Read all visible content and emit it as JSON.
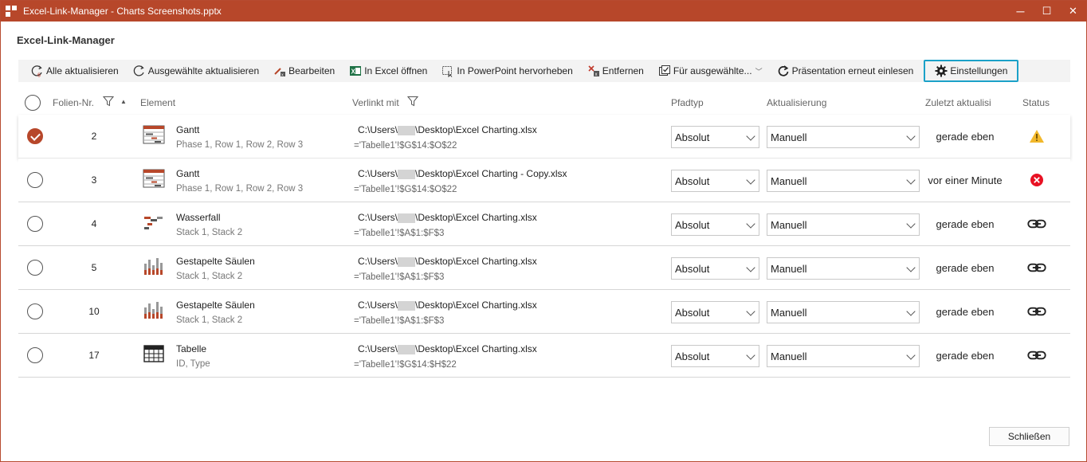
{
  "window": {
    "title": "Excel-Link-Manager - Charts Screenshots.pptx",
    "accent": "#b7472a",
    "controls": {
      "minimize": "─",
      "maximize": "☐",
      "close": "✕"
    }
  },
  "dialog": {
    "title": "Excel-Link-Manager"
  },
  "toolbar": {
    "refresh_all": "Alle aktualisieren",
    "refresh_selected": "Ausgewählte aktualisieren",
    "edit": "Bearbeiten",
    "open_excel": "In Excel öffnen",
    "highlight_ppt": "In PowerPoint hervorheben",
    "remove": "Entfernen",
    "for_selected": "Für ausgewählte...",
    "reload": "Präsentation erneut einlesen",
    "settings": "Einstellungen",
    "active_border_color": "#1ba1c8"
  },
  "columns": {
    "slide": "Folien-Nr.",
    "element": "Element",
    "linked": "Verlinkt mit",
    "path_type": "Pfadtyp",
    "update": "Aktualisierung",
    "last_updated": "Zuletzt aktualisi",
    "status": "Status"
  },
  "rows": [
    {
      "selected": true,
      "slide": "2",
      "icon": "gantt-icon",
      "name": "Gantt",
      "sub": "Phase 1, Row 1, Row 2, Row 3",
      "path_a": "C:\\Users\\",
      "path_b": "\\Desktop\\Excel Charting.xlsx",
      "range": "='Tabelle1'!$G$14:$O$22",
      "path_type": "Absolut",
      "update": "Manuell",
      "updated": "gerade eben",
      "status": "warning-icon"
    },
    {
      "selected": false,
      "slide": "3",
      "icon": "gantt-icon",
      "name": "Gantt",
      "sub": "Phase 1, Row 1, Row 2, Row 3",
      "path_a": "C:\\Users\\",
      "path_b": "\\Desktop\\Excel Charting - Copy.xlsx",
      "range": "='Tabelle1'!$G$14:$O$22",
      "path_type": "Absolut",
      "update": "Manuell",
      "updated": "vor einer Minute",
      "status": "error-icon"
    },
    {
      "selected": false,
      "slide": "4",
      "icon": "waterfall-icon",
      "name": "Wasserfall",
      "sub": "Stack 1, Stack 2",
      "path_a": "C:\\Users\\",
      "path_b": "\\Desktop\\Excel Charting.xlsx",
      "range": "='Tabelle1'!$A$1:$F$3",
      "path_type": "Absolut",
      "update": "Manuell",
      "updated": "gerade eben",
      "status": "link-icon"
    },
    {
      "selected": false,
      "slide": "5",
      "icon": "stacked-bar-icon",
      "name": "Gestapelte Säulen",
      "sub": "Stack 1, Stack 2",
      "path_a": "C:\\Users\\",
      "path_b": "\\Desktop\\Excel Charting.xlsx",
      "range": "='Tabelle1'!$A$1:$F$3",
      "path_type": "Absolut",
      "update": "Manuell",
      "updated": "gerade eben",
      "status": "link-icon"
    },
    {
      "selected": false,
      "slide": "10",
      "icon": "stacked-bar-icon",
      "name": "Gestapelte Säulen",
      "sub": "Stack 1, Stack 2",
      "path_a": "C:\\Users\\",
      "path_b": "\\Desktop\\Excel Charting.xlsx",
      "range": "='Tabelle1'!$A$1:$F$3",
      "path_type": "Absolut",
      "update": "Manuell",
      "updated": "gerade eben",
      "status": "link-icon"
    },
    {
      "selected": false,
      "slide": "17",
      "icon": "table-icon",
      "name": "Tabelle",
      "sub": "ID, Type",
      "path_a": "C:\\Users\\",
      "path_b": "\\Desktop\\Excel Charting.xlsx",
      "range": "='Tabelle1'!$G$14:$H$22",
      "path_type": "Absolut",
      "update": "Manuell",
      "updated": "gerade eben",
      "status": "link-icon"
    }
  ],
  "footer": {
    "close": "Schließen"
  }
}
